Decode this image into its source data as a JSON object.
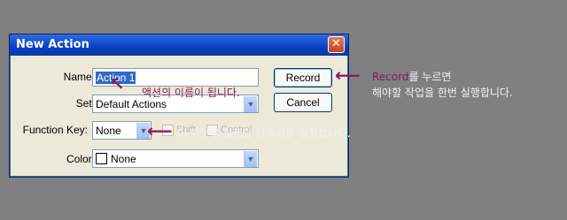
{
  "dialog": {
    "title": "New Action",
    "close_glyph": "✕",
    "name_label": "Name:",
    "name_value": "Action 1",
    "set_label": "Set:",
    "set_value": "Default Actions",
    "function_key_label": "Function Key:",
    "function_key_value": "None",
    "shift_label": "Shift",
    "control_label": "Control",
    "color_label": "Color:",
    "color_value": "None",
    "record_label": "Record",
    "cancel_label": "Cancel"
  },
  "annotations": {
    "name_note": "액션의 이름이 됩니다.",
    "function_note": "이 액션을 실행할 단축키를 설정합니다.",
    "record_word": "Record",
    "record_note_1": "를 누르면",
    "record_note_2": "해야할 작업을 한번 실행합니다."
  },
  "icons": {
    "dropdown": "chevron-down-icon",
    "arrow": "left-arrow-icon"
  },
  "colors": {
    "titlebar": "#0a3fbf",
    "dialog_bg": "#ece9d8",
    "annotation": "#8b1a5a",
    "background": "#808080"
  }
}
